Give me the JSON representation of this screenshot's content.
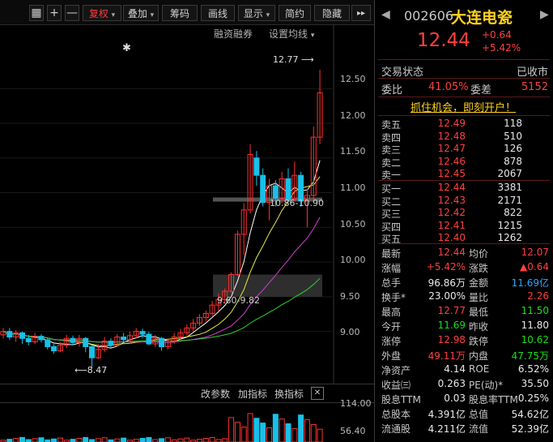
{
  "toolbar": {
    "add_symbol": "+",
    "minus_symbol": "—",
    "fuquan": "复权",
    "overlay": "叠加",
    "chips": "筹码",
    "draw_line": "画线",
    "display": "显示",
    "simple": "简约",
    "hide": "隐藏",
    "more": "▸▸"
  },
  "chart": {
    "links": {
      "margin": "融资融券",
      "ma_settings": "设置均线"
    },
    "marker_star": "✱",
    "y_axis": [
      "12.50",
      "12.00",
      "11.50",
      "11.00",
      "10.50",
      "10.00",
      "9.50",
      "9.00"
    ],
    "annotations": {
      "high": "12.77",
      "low": "8.47",
      "range1": "10.86-10.90",
      "range2": "9.60-9.82"
    },
    "indicator_bar": {
      "change": "改参数",
      "add": "加指标",
      "swap": "换指标",
      "close": "✕"
    },
    "volume_axis": [
      "114.00",
      "56.40"
    ],
    "colors": {
      "up": "#ff3030",
      "down": "#18c0e8",
      "ma5": "#ffffff",
      "ma10": "#e8e84a",
      "ma20": "#d040d0",
      "ma60": "#30d030"
    }
  },
  "chart_data": {
    "type": "candlestick",
    "ylim": [
      8.4,
      12.9
    ],
    "candles": [
      {
        "o": 8.95,
        "c": 9.0,
        "h": 9.05,
        "l": 8.9
      },
      {
        "o": 9.0,
        "c": 8.92,
        "h": 9.05,
        "l": 8.88
      },
      {
        "o": 8.92,
        "c": 8.98,
        "h": 9.02,
        "l": 8.85
      },
      {
        "o": 8.98,
        "c": 8.9,
        "h": 9.0,
        "l": 8.82
      },
      {
        "o": 8.9,
        "c": 8.85,
        "h": 8.95,
        "l": 8.8
      },
      {
        "o": 8.85,
        "c": 8.93,
        "h": 8.98,
        "l": 8.82
      },
      {
        "o": 8.93,
        "c": 8.88,
        "h": 8.96,
        "l": 8.84
      },
      {
        "o": 8.88,
        "c": 8.78,
        "h": 8.9,
        "l": 8.74
      },
      {
        "o": 8.78,
        "c": 8.72,
        "h": 8.82,
        "l": 8.68
      },
      {
        "o": 8.72,
        "c": 8.8,
        "h": 8.85,
        "l": 8.7
      },
      {
        "o": 8.8,
        "c": 8.9,
        "h": 8.95,
        "l": 8.76
      },
      {
        "o": 8.9,
        "c": 8.84,
        "h": 8.94,
        "l": 8.8
      },
      {
        "o": 8.84,
        "c": 8.9,
        "h": 8.95,
        "l": 8.78
      },
      {
        "o": 8.9,
        "c": 8.78,
        "h": 8.92,
        "l": 8.7
      },
      {
        "o": 8.78,
        "c": 8.62,
        "h": 8.8,
        "l": 8.47
      },
      {
        "o": 8.62,
        "c": 8.74,
        "h": 8.82,
        "l": 8.6
      },
      {
        "o": 8.74,
        "c": 8.86,
        "h": 8.92,
        "l": 8.7
      },
      {
        "o": 8.86,
        "c": 8.8,
        "h": 8.9,
        "l": 8.76
      },
      {
        "o": 8.8,
        "c": 8.92,
        "h": 8.96,
        "l": 8.78
      },
      {
        "o": 8.92,
        "c": 8.88,
        "h": 8.98,
        "l": 8.84
      },
      {
        "o": 8.88,
        "c": 8.94,
        "h": 9.0,
        "l": 8.82
      },
      {
        "o": 8.94,
        "c": 9.0,
        "h": 9.05,
        "l": 8.9
      },
      {
        "o": 9.0,
        "c": 8.96,
        "h": 9.04,
        "l": 8.9
      },
      {
        "o": 8.96,
        "c": 8.82,
        "h": 9.0,
        "l": 8.8
      },
      {
        "o": 8.82,
        "c": 8.9,
        "h": 8.95,
        "l": 8.78
      },
      {
        "o": 8.9,
        "c": 8.78,
        "h": 8.92,
        "l": 8.72
      },
      {
        "o": 8.78,
        "c": 8.86,
        "h": 8.9,
        "l": 8.74
      },
      {
        "o": 8.86,
        "c": 8.92,
        "h": 8.98,
        "l": 8.82
      },
      {
        "o": 8.92,
        "c": 8.98,
        "h": 9.04,
        "l": 8.88
      },
      {
        "o": 8.98,
        "c": 9.05,
        "h": 9.1,
        "l": 8.94
      },
      {
        "o": 9.05,
        "c": 9.12,
        "h": 9.18,
        "l": 9.0
      },
      {
        "o": 9.12,
        "c": 9.2,
        "h": 9.25,
        "l": 9.08
      },
      {
        "o": 9.2,
        "c": 9.26,
        "h": 9.3,
        "l": 9.15
      },
      {
        "o": 9.26,
        "c": 9.38,
        "h": 9.44,
        "l": 9.22
      },
      {
        "o": 9.38,
        "c": 9.46,
        "h": 9.55,
        "l": 9.3
      },
      {
        "o": 9.46,
        "c": 9.58,
        "h": 9.62,
        "l": 9.4
      },
      {
        "o": 9.58,
        "c": 9.82,
        "h": 9.85,
        "l": 9.55
      },
      {
        "o": 9.82,
        "c": 10.4,
        "h": 10.45,
        "l": 9.8
      },
      {
        "o": 10.4,
        "c": 10.75,
        "h": 10.85,
        "l": 10.1
      },
      {
        "o": 10.75,
        "c": 11.55,
        "h": 11.7,
        "l": 10.7
      },
      {
        "o": 11.5,
        "c": 11.25,
        "h": 11.6,
        "l": 11.1
      },
      {
        "o": 11.25,
        "c": 10.86,
        "h": 11.35,
        "l": 10.8
      },
      {
        "o": 10.86,
        "c": 11.1,
        "h": 11.2,
        "l": 10.6
      },
      {
        "o": 11.1,
        "c": 10.92,
        "h": 11.18,
        "l": 10.8
      },
      {
        "o": 10.92,
        "c": 11.2,
        "h": 11.3,
        "l": 10.85
      },
      {
        "o": 11.2,
        "c": 10.9,
        "h": 11.35,
        "l": 10.86
      },
      {
        "o": 10.9,
        "c": 11.25,
        "h": 11.45,
        "l": 10.88
      },
      {
        "o": 11.25,
        "c": 10.88,
        "h": 11.3,
        "l": 10.8
      },
      {
        "o": 10.88,
        "c": 10.96,
        "h": 11.05,
        "l": 10.5
      },
      {
        "o": 10.96,
        "c": 11.8,
        "h": 11.95,
        "l": 10.9
      },
      {
        "o": 11.8,
        "c": 12.44,
        "h": 12.77,
        "l": 11.7
      }
    ]
  },
  "panel": {
    "code": "002606",
    "name": "大连电瓷",
    "price": "12.44",
    "change": "+0.64",
    "change_pct": "+5.42%",
    "trade_status_label": "交易状态",
    "trade_status": "已收市",
    "weibi_label": "委比",
    "weibi": "41.05%",
    "weicha_label": "委差",
    "weicha": "5152",
    "promo": "抓住机会，即刻开户！",
    "sells": [
      {
        "label": "卖五",
        "price": "12.49",
        "vol": "118"
      },
      {
        "label": "卖四",
        "price": "12.48",
        "vol": "510"
      },
      {
        "label": "卖三",
        "price": "12.47",
        "vol": "126"
      },
      {
        "label": "卖二",
        "price": "12.46",
        "vol": "878"
      },
      {
        "label": "卖一",
        "price": "12.45",
        "vol": "2067"
      }
    ],
    "buys": [
      {
        "label": "买一",
        "price": "12.44",
        "vol": "3381"
      },
      {
        "label": "买二",
        "price": "12.43",
        "vol": "2171"
      },
      {
        "label": "买三",
        "price": "12.42",
        "vol": "822"
      },
      {
        "label": "买四",
        "price": "12.41",
        "vol": "1215"
      },
      {
        "label": "买五",
        "price": "12.40",
        "vol": "1262"
      }
    ],
    "stats": [
      {
        "l1": "最新",
        "v1": "12.44",
        "c1": "red",
        "l2": "均价",
        "v2": "12.07",
        "c2": "red"
      },
      {
        "l1": "涨幅",
        "v1": "+5.42%",
        "c1": "red",
        "l2": "涨跌",
        "v2": "▲0.64",
        "c2": "red"
      },
      {
        "l1": "总手",
        "v1": "96.86万",
        "c1": "white",
        "l2": "金额",
        "v2": "11.69亿",
        "c2": "blue"
      },
      {
        "l1": "换手*",
        "v1": "23.00%",
        "c1": "white",
        "l2": "量比",
        "v2": "2.26",
        "c2": "red"
      },
      {
        "l1": "最高",
        "v1": "12.77",
        "c1": "red",
        "l2": "最低",
        "v2": "11.50",
        "c2": "green"
      },
      {
        "l1": "今开",
        "v1": "11.69",
        "c1": "green",
        "l2": "昨收",
        "v2": "11.80",
        "c2": "white"
      },
      {
        "l1": "涨停",
        "v1": "12.98",
        "c1": "red",
        "l2": "跌停",
        "v2": "10.62",
        "c2": "green"
      },
      {
        "l1": "外盘",
        "v1": "49.11万",
        "c1": "red",
        "l2": "内盘",
        "v2": "47.75万",
        "c2": "green"
      },
      {
        "l1": "净资产",
        "v1": "4.14",
        "c1": "white",
        "l2": "ROE",
        "v2": "6.52%",
        "c2": "white"
      },
      {
        "l1": "收益㈢",
        "v1": "0.263",
        "c1": "white",
        "l2": "PE(动)*",
        "v2": "35.50",
        "c2": "white"
      },
      {
        "l1": "股息TTM",
        "v1": "0.03",
        "c1": "white",
        "l2": "股息率TTM",
        "v2": "0.25%",
        "c2": "white"
      },
      {
        "l1": "总股本",
        "v1": "4.391亿",
        "c1": "white",
        "l2": "总值",
        "v2": "54.62亿",
        "c2": "white"
      },
      {
        "l1": "流通股",
        "v1": "4.211亿",
        "c1": "white",
        "l2": "流值",
        "v2": "52.39亿",
        "c2": "white"
      }
    ]
  }
}
